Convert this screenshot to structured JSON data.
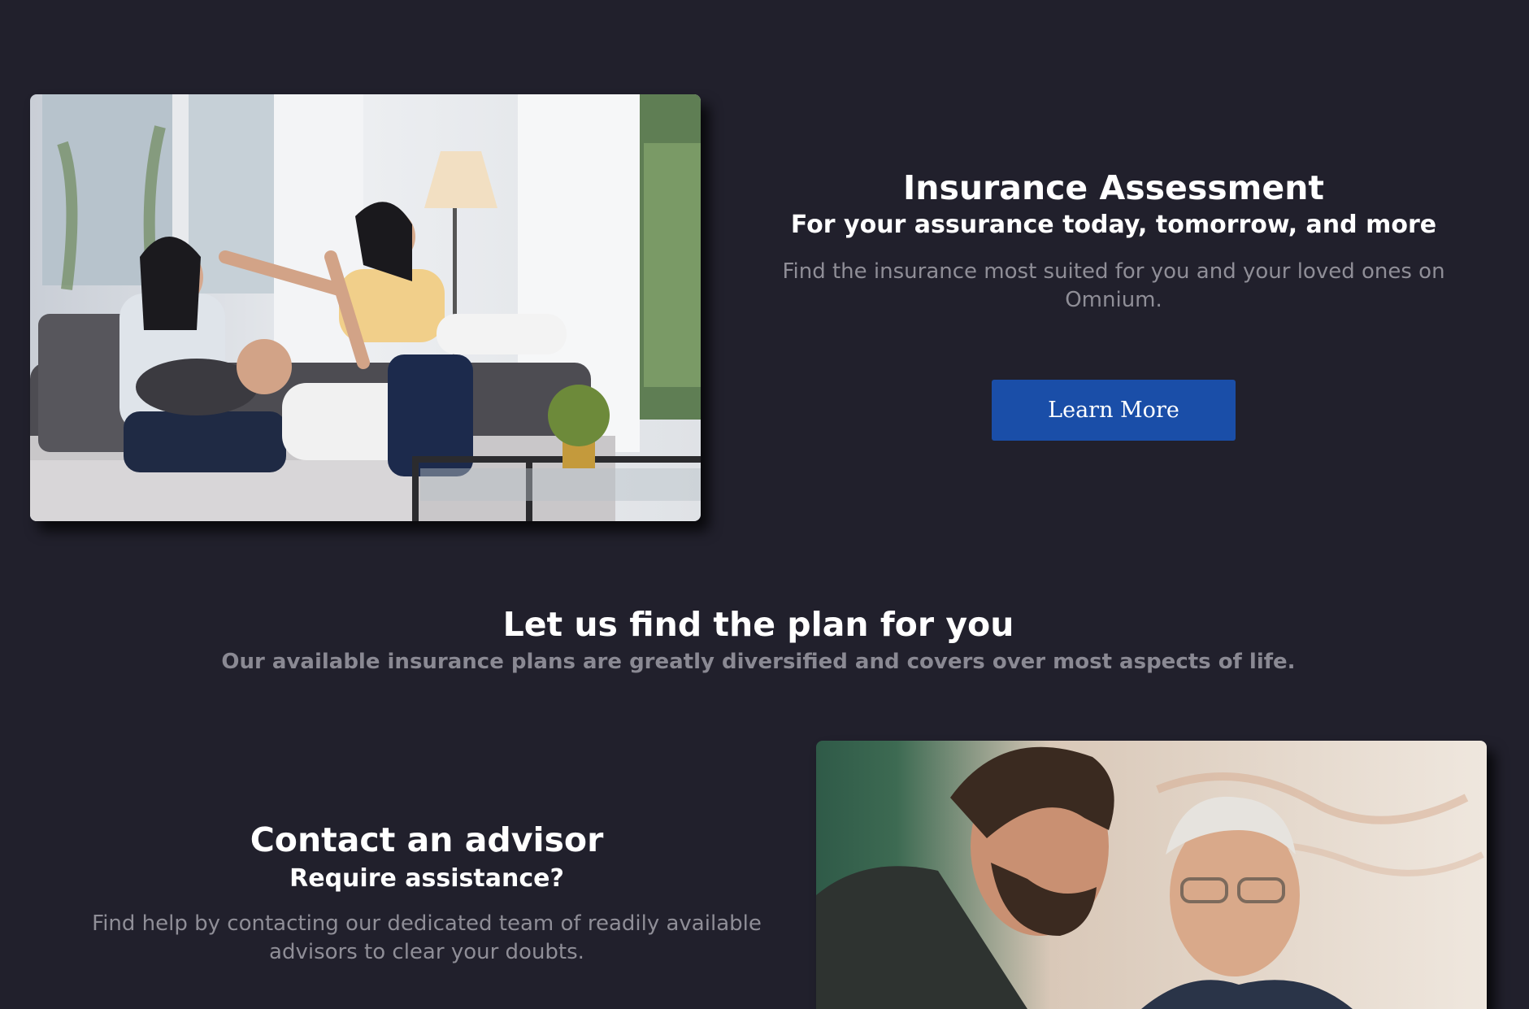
{
  "assessment": {
    "title": "Insurance Assessment",
    "subtitle": "For your assurance today, tomorrow, and more",
    "description": "Find the insurance most suited for you and your loved ones on Omnium.",
    "button_label": "Learn More"
  },
  "plans": {
    "title": "Let us find the plan for you",
    "description": "Our available insurance plans are greatly diversified and covers over most aspects of life."
  },
  "advisor": {
    "title": "Contact an advisor",
    "subtitle": "Require assistance?",
    "description": "Find help by contacting our dedicated team of readily available advisors to clear your doubts."
  },
  "colors": {
    "background": "#21202c",
    "button": "#1a4ea8",
    "muted_text": "#8f8e97"
  }
}
